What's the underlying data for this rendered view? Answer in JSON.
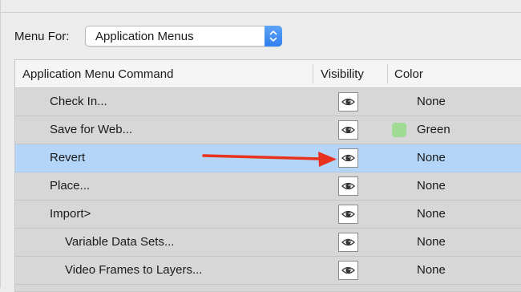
{
  "menu_for": {
    "label": "Menu For:",
    "selected": "Application Menus"
  },
  "table": {
    "columns": [
      "Application Menu Command",
      "Visibility",
      "Color"
    ],
    "rows": [
      {
        "command": "Check In...",
        "indent": 1,
        "visible": true,
        "color": "None",
        "swatch": ""
      },
      {
        "command": "Save for Web...",
        "indent": 1,
        "visible": true,
        "color": "Green",
        "swatch": "#9fdb93"
      },
      {
        "command": "Revert",
        "indent": 1,
        "visible": true,
        "color": "None",
        "swatch": "",
        "selected": true
      },
      {
        "command": "Place...",
        "indent": 1,
        "visible": true,
        "color": "None",
        "swatch": ""
      },
      {
        "command": "Import>",
        "indent": 1,
        "visible": true,
        "color": "None",
        "swatch": ""
      },
      {
        "command": "Variable Data Sets...",
        "indent": 2,
        "visible": true,
        "color": "None",
        "swatch": ""
      },
      {
        "command": "Video Frames to Layers...",
        "indent": 2,
        "visible": true,
        "color": "None",
        "swatch": ""
      }
    ]
  },
  "annotation": {
    "type": "red-arrow",
    "color": "#e8321d",
    "points_to": "Revert visibility toggle"
  }
}
